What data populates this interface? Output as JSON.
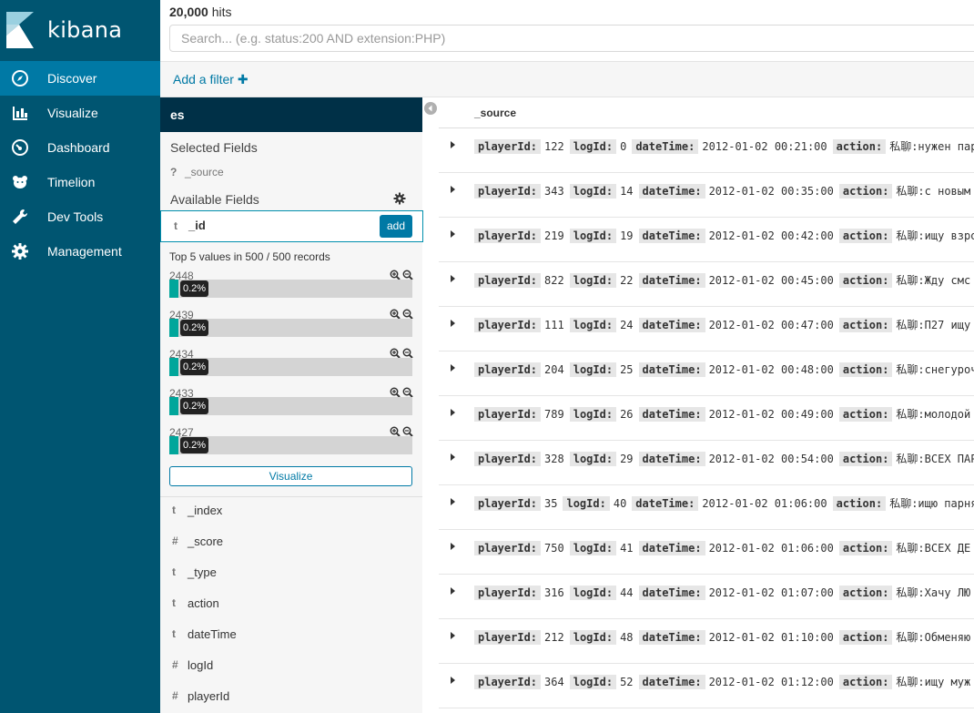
{
  "app": {
    "brand": "kibana"
  },
  "nav": {
    "items": [
      {
        "label": "Discover",
        "icon": "compass-icon",
        "active": true
      },
      {
        "label": "Visualize",
        "icon": "bar-chart-icon"
      },
      {
        "label": "Dashboard",
        "icon": "dashboard-gauge-icon"
      },
      {
        "label": "Timelion",
        "icon": "timelion-bear-icon"
      },
      {
        "label": "Dev Tools",
        "icon": "wrench-icon"
      },
      {
        "label": "Management",
        "icon": "gear-icon"
      }
    ]
  },
  "query": {
    "hits_count": "20,000",
    "hits_label": "hits",
    "placeholder": "Search... (e.g. status:200 AND extension:PHP)",
    "add_filter": "Add a filter"
  },
  "sidebar": {
    "index_pattern": "es",
    "selected_title": "Selected Fields",
    "source_field": {
      "type": "?",
      "name": "_source"
    },
    "available_title": "Available Fields",
    "expanded_field": {
      "type": "t",
      "name": "_id",
      "add_label": "add"
    },
    "top5_title": "Top 5 values in 500 / 500 records",
    "top_values": [
      {
        "value": "2448",
        "percent": "0.2%"
      },
      {
        "value": "2439",
        "percent": "0.2%"
      },
      {
        "value": "2434",
        "percent": "0.2%"
      },
      {
        "value": "2433",
        "percent": "0.2%"
      },
      {
        "value": "2427",
        "percent": "0.2%"
      }
    ],
    "visualize_label": "Visualize",
    "fields": [
      {
        "type": "t",
        "name": "_index"
      },
      {
        "type": "#",
        "name": "_score"
      },
      {
        "type": "t",
        "name": "_type"
      },
      {
        "type": "t",
        "name": "action"
      },
      {
        "type": "t",
        "name": "dateTime"
      },
      {
        "type": "#",
        "name": "logId"
      },
      {
        "type": "#",
        "name": "playerId"
      }
    ]
  },
  "table": {
    "column": "_source",
    "rows": [
      {
        "playerId": "122",
        "logId": "0",
        "dateTime": "2012-01-02 00:21:00",
        "action": "私聊:нужен пар"
      },
      {
        "playerId": "343",
        "logId": "14",
        "dateTime": "2012-01-02 00:35:00",
        "action": "私聊:с новым"
      },
      {
        "playerId": "219",
        "logId": "19",
        "dateTime": "2012-01-02 00:42:00",
        "action": "私聊:ищу взро"
      },
      {
        "playerId": "822",
        "logId": "22",
        "dateTime": "2012-01-02 00:45:00",
        "action": "私聊:Жду смс"
      },
      {
        "playerId": "111",
        "logId": "24",
        "dateTime": "2012-01-02 00:47:00",
        "action": "私聊:П27 ищу"
      },
      {
        "playerId": "204",
        "logId": "25",
        "dateTime": "2012-01-02 00:48:00",
        "action": "私聊:снегуроч"
      },
      {
        "playerId": "789",
        "logId": "26",
        "dateTime": "2012-01-02 00:49:00",
        "action": "私聊:молодой"
      },
      {
        "playerId": "328",
        "logId": "29",
        "dateTime": "2012-01-02 00:54:00",
        "action": "私聊:ВСЕХ ПАР"
      },
      {
        "playerId": "35",
        "logId": "40",
        "dateTime": "2012-01-02 01:06:00",
        "action": "私聊:ищю парня"
      },
      {
        "playerId": "750",
        "logId": "41",
        "dateTime": "2012-01-02 01:06:00",
        "action": "私聊:ВСЕХ ДЕ"
      },
      {
        "playerId": "316",
        "logId": "44",
        "dateTime": "2012-01-02 01:07:00",
        "action": "私聊:Хачу ЛЮ"
      },
      {
        "playerId": "212",
        "logId": "48",
        "dateTime": "2012-01-02 01:10:00",
        "action": "私聊:Обменяю"
      },
      {
        "playerId": "364",
        "logId": "52",
        "dateTime": "2012-01-02 01:12:00",
        "action": "私聊:ищу муж"
      }
    ],
    "keys": {
      "playerId": "playerId:",
      "logId": "logId:",
      "dateTime": "dateTime:",
      "action": "action:"
    }
  }
}
